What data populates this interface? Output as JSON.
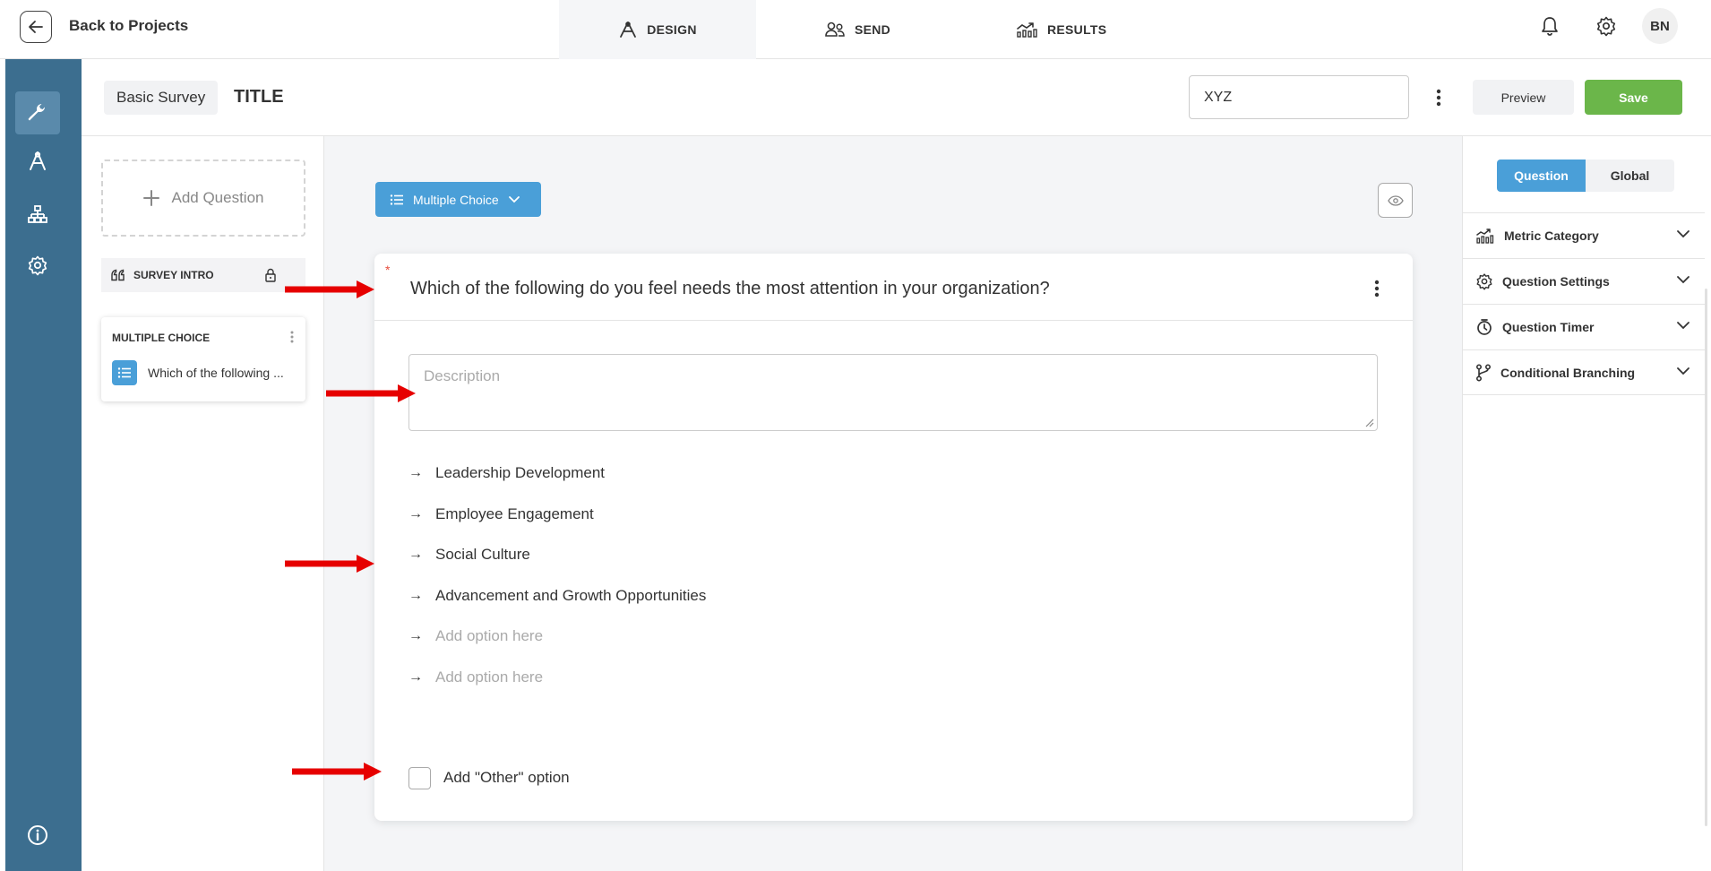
{
  "topbar": {
    "back_label": "Back to Projects",
    "tabs": [
      {
        "label": "DESIGN",
        "icon": "design-icon",
        "active": true
      },
      {
        "label": "SEND",
        "icon": "users-icon",
        "active": false
      },
      {
        "label": "RESULTS",
        "icon": "results-chart-icon",
        "active": false
      }
    ],
    "avatar_initials": "BN"
  },
  "rail": {
    "items": [
      "wrench-icon",
      "design-icon",
      "sitemap-icon",
      "gear-icon",
      "info-icon"
    ],
    "active_index": 0
  },
  "subheader": {
    "survey_type": "Basic Survey",
    "title": "TITLE",
    "name_value": "XYZ",
    "preview_label": "Preview",
    "save_label": "Save"
  },
  "left_panel": {
    "add_question_label": "Add Question",
    "survey_intro_label": "SURVEY INTRO",
    "question_card": {
      "type_label": "MULTIPLE CHOICE",
      "text": "Which of the following ..."
    }
  },
  "editor": {
    "type_dropdown_label": "Multiple Choice",
    "question_text": "Which of the following do you feel needs the most attention in your organization?",
    "description_placeholder": "Description",
    "options": [
      {
        "text": "Leadership Development",
        "placeholder": false
      },
      {
        "text": "Employee Engagement",
        "placeholder": false
      },
      {
        "text": "Social Culture",
        "placeholder": false
      },
      {
        "text": "Advancement and Growth Opportunities",
        "placeholder": false
      },
      {
        "text": "Add option here",
        "placeholder": true
      },
      {
        "text": "Add option here",
        "placeholder": true
      }
    ],
    "other_option_label": "Add \"Other\" option",
    "other_checked": false
  },
  "right_panel": {
    "segments": [
      "Question",
      "Global"
    ],
    "active_segment": "Question",
    "accordions": [
      {
        "label": "Metric Category",
        "icon": "metric-chart-icon"
      },
      {
        "label": "Question Settings",
        "icon": "gear-icon"
      },
      {
        "label": "Question Timer",
        "icon": "timer-icon"
      },
      {
        "label": "Conditional Branching",
        "icon": "branch-icon"
      }
    ]
  },
  "colors": {
    "rail": "#3c6e8f",
    "primary": "#4a9fd8",
    "save": "#6bb64a",
    "annotation_arrow": "#e60000",
    "required": "#e74c3c"
  }
}
